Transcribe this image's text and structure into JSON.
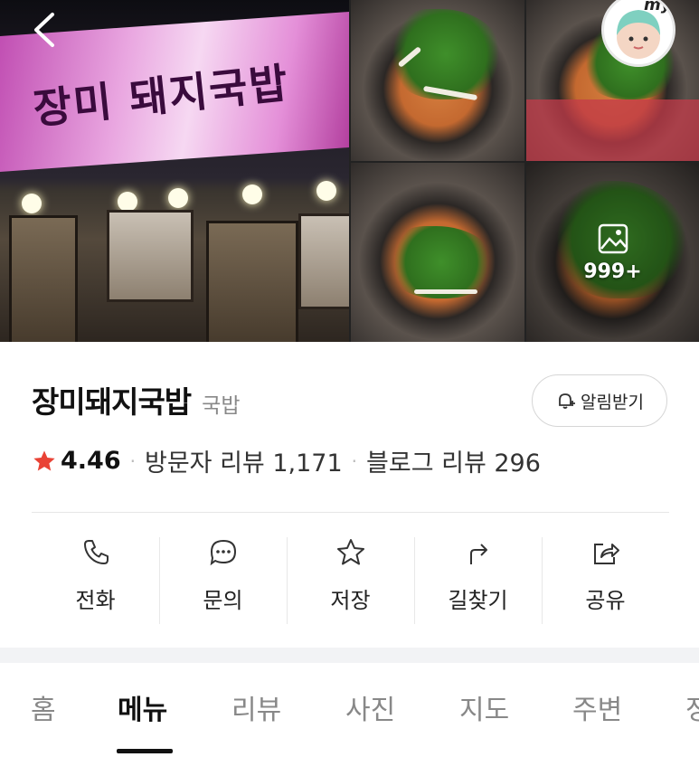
{
  "header": {
    "back_icon": "chevron-left-icon",
    "avatar_badge": "my",
    "photo_count": "999+",
    "sign_text": "장미 돼지국밥"
  },
  "place": {
    "name": "장미돼지국밥",
    "category": "국밥",
    "alarm_label": "알림받기",
    "rating": "4.46",
    "visitor_reviews": "방문자 리뷰 1,171",
    "blog_reviews": "블로그 리뷰 296",
    "star_color": "#e94235"
  },
  "actions": [
    {
      "label": "전화",
      "icon": "phone-icon"
    },
    {
      "label": "문의",
      "icon": "chat-icon"
    },
    {
      "label": "저장",
      "icon": "star-outline-icon"
    },
    {
      "label": "길찾기",
      "icon": "directions-icon"
    },
    {
      "label": "공유",
      "icon": "share-icon"
    }
  ],
  "tabs": [
    {
      "label": "홈",
      "active": false
    },
    {
      "label": "메뉴",
      "active": true
    },
    {
      "label": "리뷰",
      "active": false
    },
    {
      "label": "사진",
      "active": false
    },
    {
      "label": "지도",
      "active": false
    },
    {
      "label": "주변",
      "active": false
    },
    {
      "label": "정",
      "active": false
    }
  ]
}
